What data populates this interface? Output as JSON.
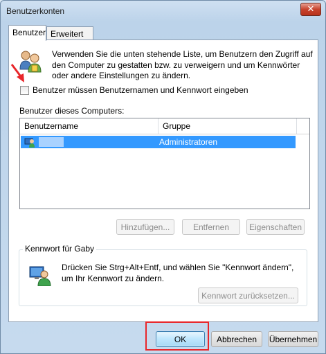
{
  "window": {
    "title": "Benutzerkonten",
    "close_label": "✕"
  },
  "tabs": [
    {
      "label": "Benutzer"
    },
    {
      "label": "Erweitert"
    }
  ],
  "intro": {
    "text": "Verwenden Sie die unten stehende Liste, um Benutzern den Zugriff auf den Computer zu gestatten bzw. zu verweigern und um Kennwörter oder andere Einstellungen zu ändern."
  },
  "checkbox": {
    "label": "Benutzer müssen Benutzernamen und Kennwort eingeben",
    "checked": false
  },
  "users_list": {
    "label": "Benutzer dieses Computers:",
    "columns": [
      "Benutzername",
      "Gruppe"
    ],
    "rows": [
      {
        "username": "",
        "group": "Administratoren"
      }
    ]
  },
  "user_buttons": {
    "add": "Hinzufügen...",
    "remove": "Entfernen",
    "properties": "Eigenschaften"
  },
  "password_group": {
    "title": "Kennwort für Gaby",
    "text": "Drücken Sie Strg+Alt+Entf, und wählen Sie \"Kennwort ändern\", um Ihr Kennwort zu ändern.",
    "reset_button": "Kennwort zurücksetzen..."
  },
  "footer": {
    "ok": "OK",
    "cancel": "Abbrechen",
    "apply": "Übernehmen"
  },
  "colors": {
    "selection": "#3399ff",
    "highlight": "#e8262a"
  }
}
